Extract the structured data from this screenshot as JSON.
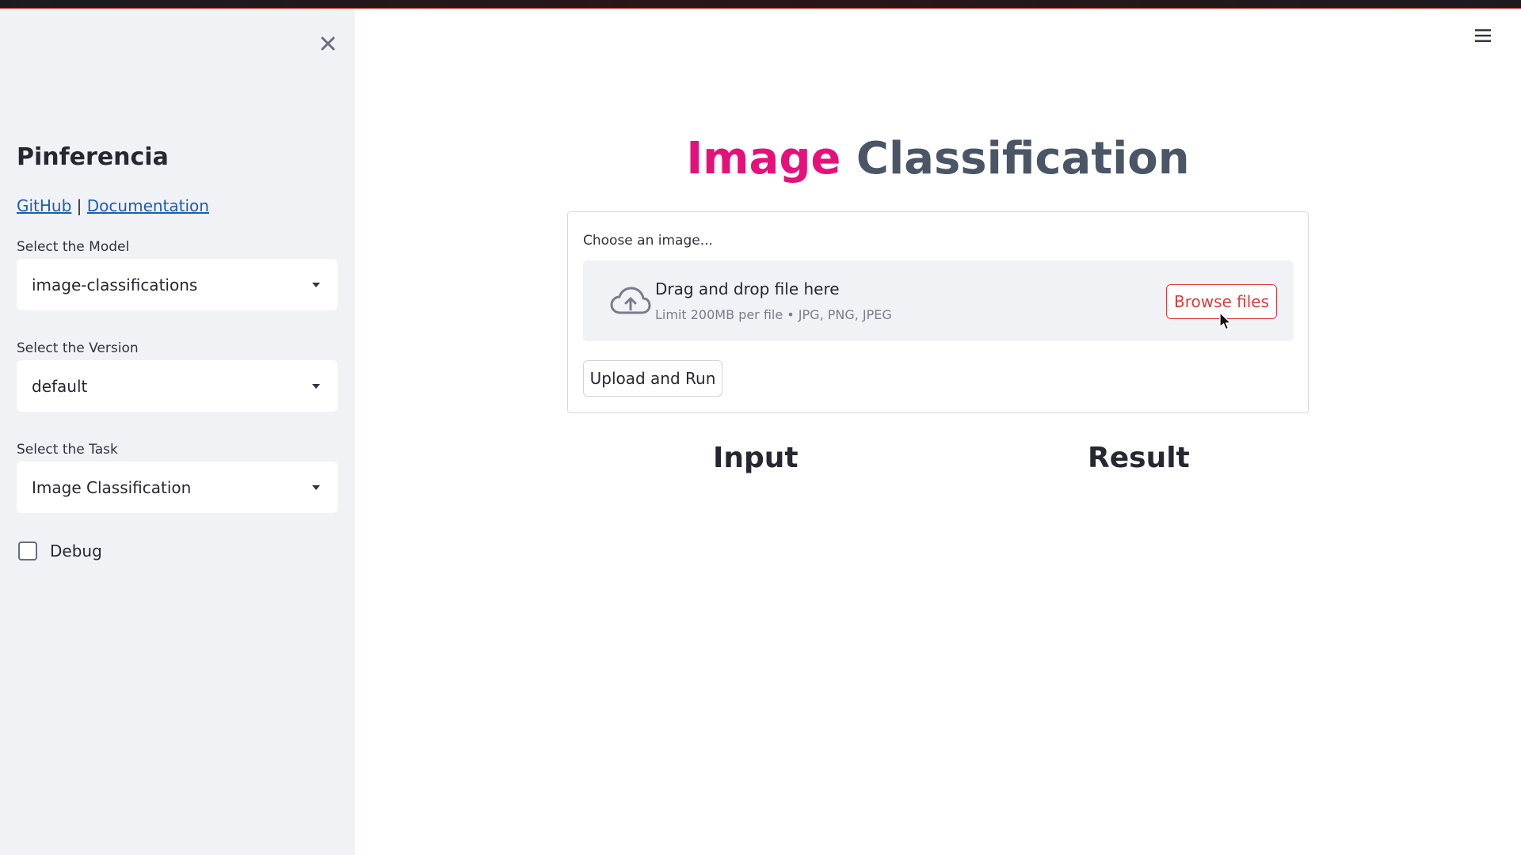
{
  "app": {
    "brand": "Pinferencia",
    "links": {
      "github": "GitHub",
      "separator": "|",
      "documentation": "Documentation"
    }
  },
  "sidebar": {
    "model": {
      "label": "Select the Model",
      "value": "image-classifications"
    },
    "version": {
      "label": "Select the Version",
      "value": "default"
    },
    "task": {
      "label": "Select the Task",
      "value": "Image Classification"
    },
    "debug": {
      "label": "Debug",
      "checked": false
    }
  },
  "main": {
    "title_word1": "Image",
    "title_word2": "Classification",
    "uploader": {
      "label": "Choose an image...",
      "drop_text": "Drag and drop file here",
      "limit_text": "Limit 200MB per file • JPG, PNG, JPEG",
      "browse_label": "Browse files"
    },
    "run_label": "Upload and Run",
    "columns": {
      "input": "Input",
      "result": "Result"
    }
  },
  "icons": {
    "close": "close-icon",
    "menu": "hamburger-menu-icon",
    "upload": "cloud-upload-icon",
    "caret": "chevron-down-icon"
  },
  "colors": {
    "title_accent": "#e6107a",
    "title_main": "#4a5565",
    "browse_accent": "#e03b3b",
    "link": "#1a5fb4",
    "sidebar_bg": "#f0f2f6"
  }
}
